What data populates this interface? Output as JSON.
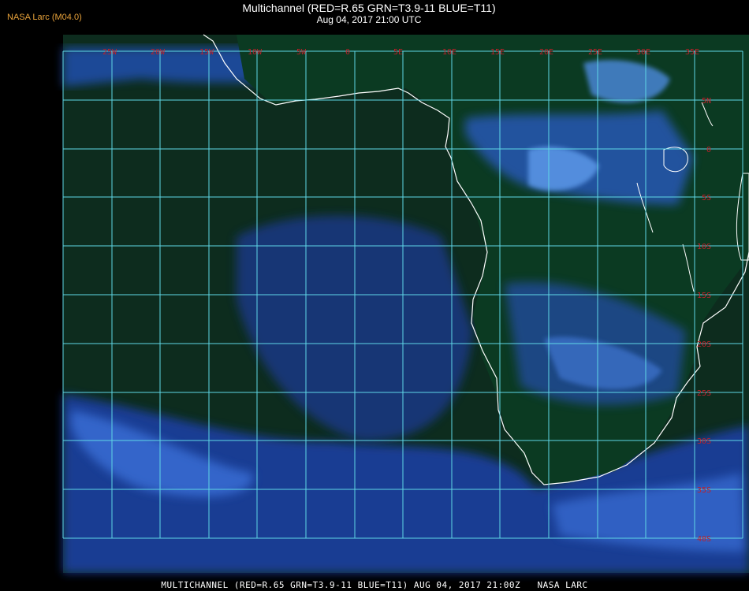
{
  "header": {
    "credit": "NASA Larc (M04.0)",
    "title": "Multichannel (RED=R.65 GRN=T3.9-11 BLUE=T11)",
    "datetime": "Aug 04, 2017 21:00 UTC"
  },
  "grid": {
    "longitude_labels": [
      "25W",
      "20W",
      "15W",
      "10W",
      "5W",
      "0",
      "5E",
      "10E",
      "15E",
      "20E",
      "25E",
      "30E",
      "35E"
    ],
    "latitude_labels": [
      "5N",
      "0",
      "5S",
      "10S",
      "15S",
      "20S",
      "25S",
      "30S",
      "35S",
      "40S"
    ],
    "line_color": "#5fd7e6",
    "label_color": "#c0202a",
    "coast_color": "#ffffff"
  },
  "imagery": {
    "ocean_color": "#1a2c8a",
    "land_color": "#0c3a18",
    "cloud_color": "#3a7ad8",
    "bright_cloud_color": "#6aa8f0"
  },
  "footer": {
    "text": "MULTICHANNEL (RED=R.65 GRN=T3.9-11 BLUE=T11) AUG 04, 2017 21:00Z   NASA LARC"
  }
}
